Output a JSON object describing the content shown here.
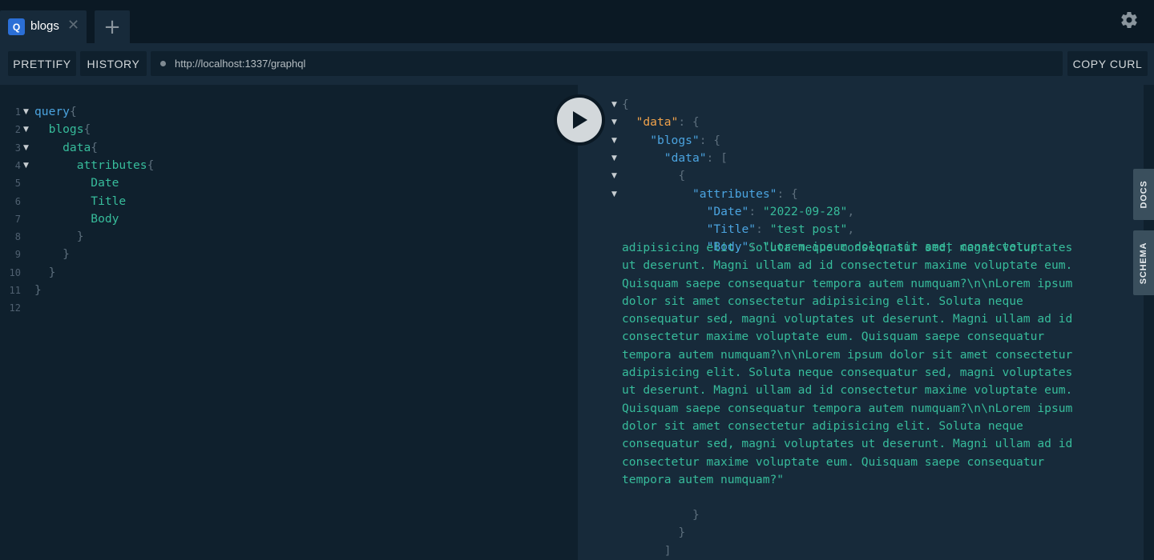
{
  "tabbar": {
    "tabs": [
      {
        "badge": "Q",
        "title": "blogs",
        "close": "✕"
      }
    ],
    "add_label": "+"
  },
  "settings_icon": "gear-icon",
  "toolbar": {
    "prettify_label": "PRETTIFY",
    "history_label": "HISTORY",
    "endpoint_url": "http://localhost:1337/graphql",
    "copy_curl_label": "COPY CURL"
  },
  "editor": {
    "lines": [
      {
        "num": "1",
        "fold": true,
        "tokens": [
          {
            "t": "query",
            "c": "kw"
          },
          {
            "t": "{",
            "c": "punc"
          }
        ]
      },
      {
        "num": "2",
        "fold": true,
        "tokens": [
          {
            "t": "  blogs",
            "c": "fld"
          },
          {
            "t": "{",
            "c": "punc"
          }
        ]
      },
      {
        "num": "3",
        "fold": true,
        "tokens": [
          {
            "t": "    data",
            "c": "fld"
          },
          {
            "t": "{",
            "c": "punc"
          }
        ]
      },
      {
        "num": "4",
        "fold": true,
        "tokens": [
          {
            "t": "      attributes",
            "c": "fld"
          },
          {
            "t": "{",
            "c": "punc"
          }
        ]
      },
      {
        "num": "5",
        "fold": false,
        "tokens": [
          {
            "t": "        Date",
            "c": "fld"
          }
        ]
      },
      {
        "num": "6",
        "fold": false,
        "tokens": [
          {
            "t": "        Title",
            "c": "fld"
          }
        ]
      },
      {
        "num": "7",
        "fold": false,
        "tokens": [
          {
            "t": "        Body",
            "c": "fld"
          }
        ]
      },
      {
        "num": "8",
        "fold": false,
        "tokens": [
          {
            "t": "      }",
            "c": "punc"
          }
        ]
      },
      {
        "num": "9",
        "fold": false,
        "tokens": [
          {
            "t": "    }",
            "c": "punc"
          }
        ]
      },
      {
        "num": "10",
        "fold": false,
        "tokens": [
          {
            "t": "  }",
            "c": "punc"
          }
        ]
      },
      {
        "num": "11",
        "fold": false,
        "tokens": [
          {
            "t": "}",
            "c": "punc"
          }
        ]
      },
      {
        "num": "12",
        "fold": false,
        "tokens": []
      }
    ]
  },
  "result": {
    "lines": [
      {
        "fold": true,
        "indent": 0,
        "tokens": [
          {
            "t": "{",
            "c": "jp"
          }
        ]
      },
      {
        "fold": true,
        "indent": 1,
        "tokens": [
          {
            "t": "\"data\"",
            "c": "jtop"
          },
          {
            "t": ": {",
            "c": "jp"
          }
        ]
      },
      {
        "fold": true,
        "indent": 2,
        "tokens": [
          {
            "t": "\"blogs\"",
            "c": "jkey"
          },
          {
            "t": ": {",
            "c": "jp"
          }
        ]
      },
      {
        "fold": true,
        "indent": 3,
        "tokens": [
          {
            "t": "\"data\"",
            "c": "jkey"
          },
          {
            "t": ": [",
            "c": "jp"
          }
        ]
      },
      {
        "fold": true,
        "indent": 4,
        "tokens": [
          {
            "t": "{",
            "c": "jp"
          }
        ]
      },
      {
        "fold": true,
        "indent": 5,
        "tokens": [
          {
            "t": "\"attributes\"",
            "c": "jkey"
          },
          {
            "t": ": {",
            "c": "jp"
          }
        ]
      },
      {
        "fold": false,
        "indent": 6,
        "tokens": [
          {
            "t": "\"Date\"",
            "c": "jkey"
          },
          {
            "t": ": ",
            "c": "jp"
          },
          {
            "t": "\"2022-09-28\"",
            "c": "jstr"
          },
          {
            "t": ",",
            "c": "jp"
          }
        ]
      },
      {
        "fold": false,
        "indent": 6,
        "tokens": [
          {
            "t": "\"Title\"",
            "c": "jkey"
          },
          {
            "t": ": ",
            "c": "jp"
          },
          {
            "t": "\"test post\"",
            "c": "jstr"
          },
          {
            "t": ",",
            "c": "jp"
          }
        ]
      },
      {
        "fold": false,
        "indent": 6,
        "tokens": [
          {
            "t": "\"Body\"",
            "c": "jkey"
          },
          {
            "t": ": ",
            "c": "jp"
          },
          {
            "t": "\"Lorem ipsum dolor sit amet consectetur",
            "c": "jstr"
          }
        ]
      }
    ],
    "body_wrapped": [
      "adipisicing elit. Soluta neque consequatur sed, magni voluptates",
      "ut deserunt. Magni ullam ad id consectetur maxime voluptate eum.",
      "Quisquam saepe consequatur tempora autem numquam?\\n\\nLorem ipsum",
      "dolor sit amet consectetur adipisicing elit. Soluta neque",
      "consequatur sed, magni voluptates ut deserunt. Magni ullam ad id",
      "consectetur maxime voluptate eum. Quisquam saepe consequatur",
      "tempora autem numquam?\\n\\nLorem ipsum dolor sit amet consectetur",
      "adipisicing elit. Soluta neque consequatur sed, magni voluptates",
      "ut deserunt. Magni ullam ad id consectetur maxime voluptate eum.",
      "Quisquam saepe consequatur tempora autem numquam?\\n\\nLorem ipsum",
      "dolor sit amet consectetur adipisicing elit. Soluta neque",
      "consequatur sed, magni voluptates ut deserunt. Magni ullam ad id",
      "consectetur maxime voluptate eum. Quisquam saepe consequatur",
      "tempora autem numquam?\""
    ],
    "closing": [
      {
        "indent": 5,
        "t": "}"
      },
      {
        "indent": 4,
        "t": "}"
      },
      {
        "indent": 3,
        "t": "]"
      }
    ]
  },
  "side_tabs": {
    "docs_label": "DOCS",
    "schema_label": "SCHEMA"
  },
  "colors": {
    "keyword": "#4ba4e0",
    "field": "#37bc9b",
    "top_key": "#f0a24b",
    "punctuation": "#5c6e7c"
  }
}
